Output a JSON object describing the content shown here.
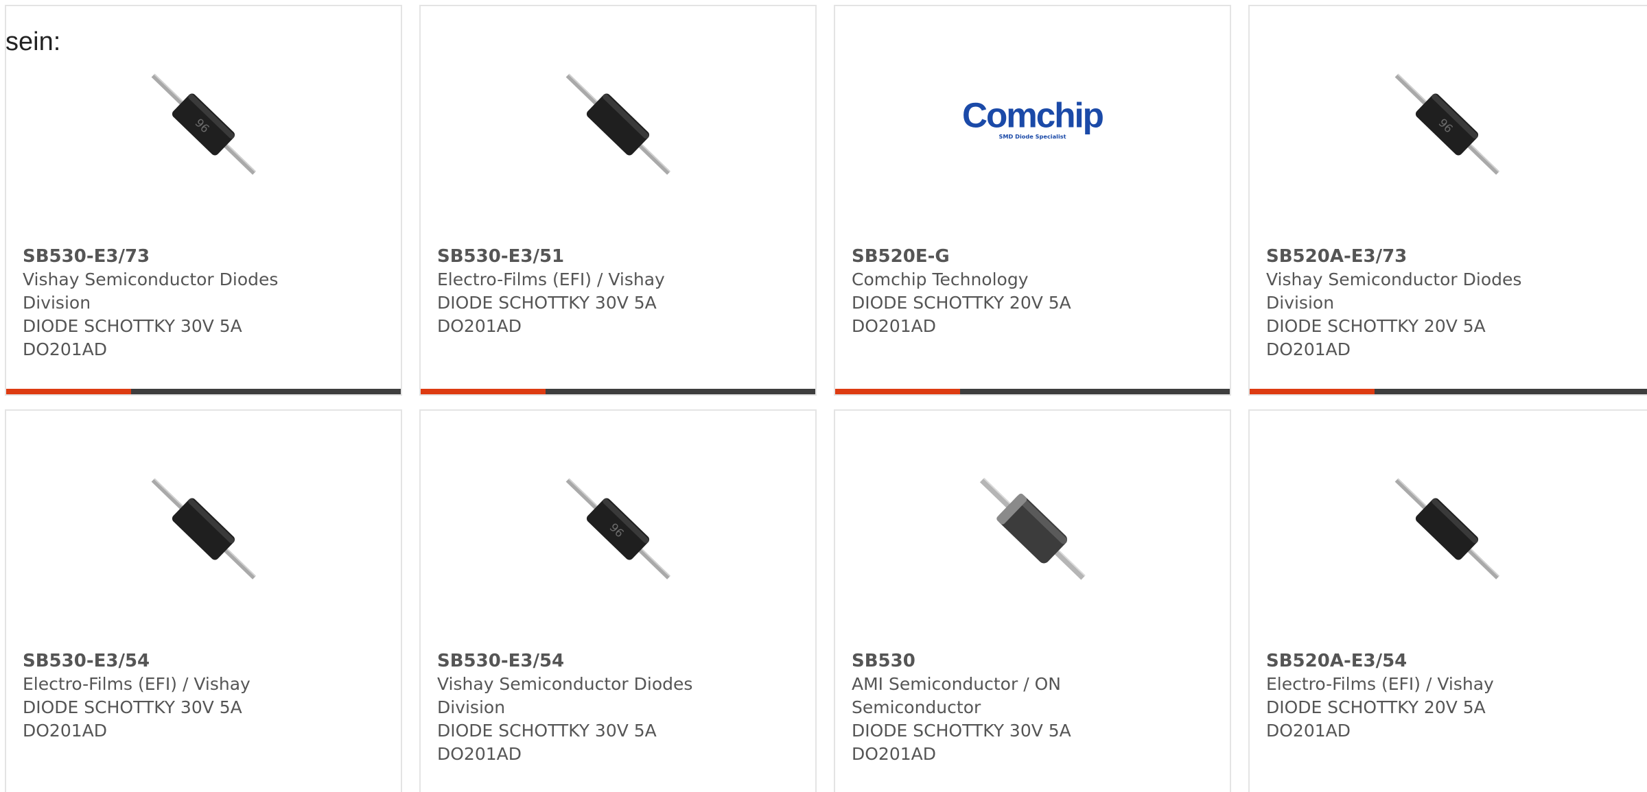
{
  "intro_text": "sein:",
  "accent_color": "#dd3b12",
  "bar_color": "#3e3e3e",
  "products": [
    {
      "part": "SB530-E3/73",
      "manufacturer": "Vishay Semiconductor Diodes Division",
      "description": "DIODE SCHOTTKY 30V 5A DO201AD",
      "image": "diode-icon"
    },
    {
      "part": "SB530-E3/51",
      "manufacturer": "Electro-Films (EFI) / Vishay",
      "description": "DIODE SCHOTTKY 30V 5A DO201AD",
      "image": "diode-icon"
    },
    {
      "part": "SB520E-G",
      "manufacturer": "Comchip Technology",
      "description": "DIODE SCHOTTKY 20V 5A DO201AD",
      "image": "comchip-logo",
      "logo_text": "Comchip",
      "logo_tagline": "SMD Diode Specialist"
    },
    {
      "part": "SB520A-E3/73",
      "manufacturer": "Vishay Semiconductor Diodes Division",
      "description": "DIODE SCHOTTKY 20V 5A DO201AD",
      "image": "diode-icon"
    },
    {
      "part": "SB530-E3/54",
      "manufacturer": "Electro-Films (EFI) / Vishay",
      "description": "DIODE SCHOTTKY 30V 5A DO201AD",
      "image": "diode-icon"
    },
    {
      "part": "SB530-E3/54",
      "manufacturer": "Vishay Semiconductor Diodes Division",
      "description": "DIODE SCHOTTKY 30V 5A DO201AD",
      "image": "diode-icon"
    },
    {
      "part": "SB530",
      "manufacturer": "AMI Semiconductor / ON Semiconductor",
      "description": "DIODE SCHOTTKY 30V 5A DO201AD",
      "image": "diode-icon"
    },
    {
      "part": "SB520A-E3/54",
      "manufacturer": "Electro-Films (EFI) / Vishay",
      "description": "DIODE SCHOTTKY 20V 5A DO201AD",
      "image": "diode-icon"
    }
  ]
}
